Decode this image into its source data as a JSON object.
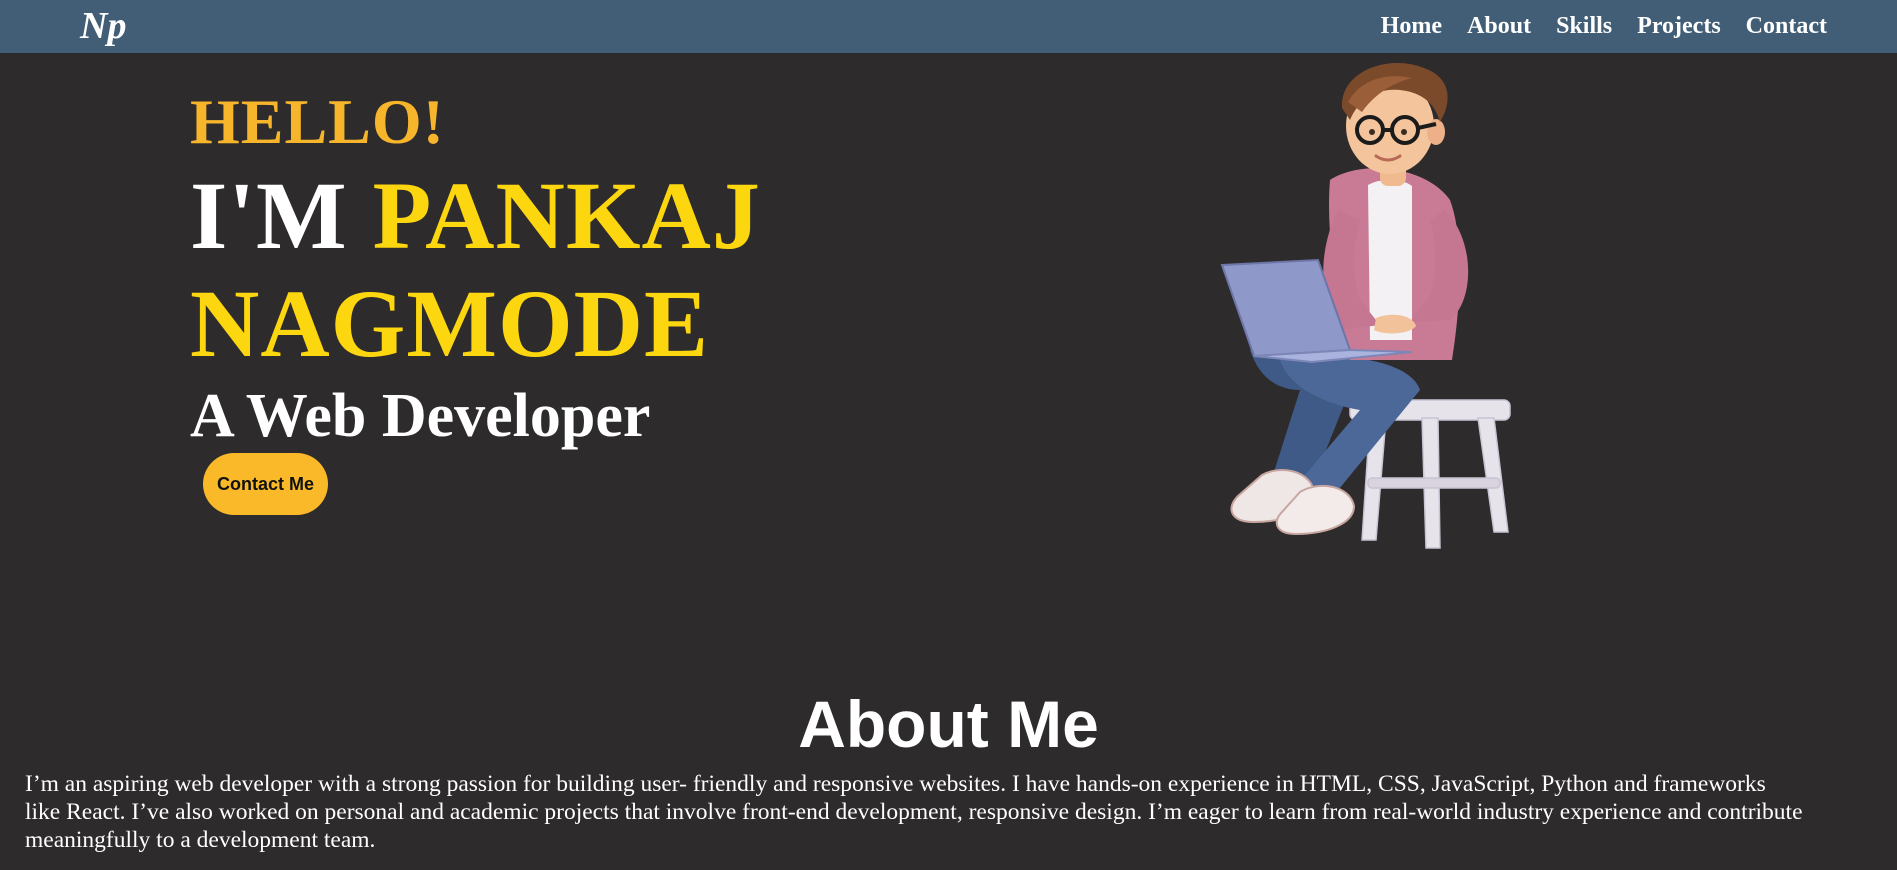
{
  "header": {
    "logo": "Np",
    "nav": [
      "Home",
      "About",
      "Skills",
      "Projects",
      "Contact"
    ]
  },
  "hero": {
    "greeting": "HELLO!",
    "im": "I'M",
    "first_name": "PANKAJ",
    "last_name": "NAGMODE",
    "role": "A Web Developer",
    "cta_label": "Contact Me",
    "illustration_icon": "developer-with-laptop-illustration"
  },
  "about": {
    "title": "About Me",
    "text": "I’m an aspiring web developer with a strong passion for building user- friendly and responsive websites. I have hands-on experience in HTML, CSS, JavaScript, Python and frameworks like React. I’ve also worked on personal and academic projects that involve front-end development, responsive design. I’m eager to learn from real-world industry experience and contribute meaningfully to a development team."
  },
  "colors": {
    "background": "#2e2b2c",
    "navbar": "#425e76",
    "greeting": "#f7b52b",
    "name_highlight": "#fcd60e",
    "button": "#f9b928"
  }
}
